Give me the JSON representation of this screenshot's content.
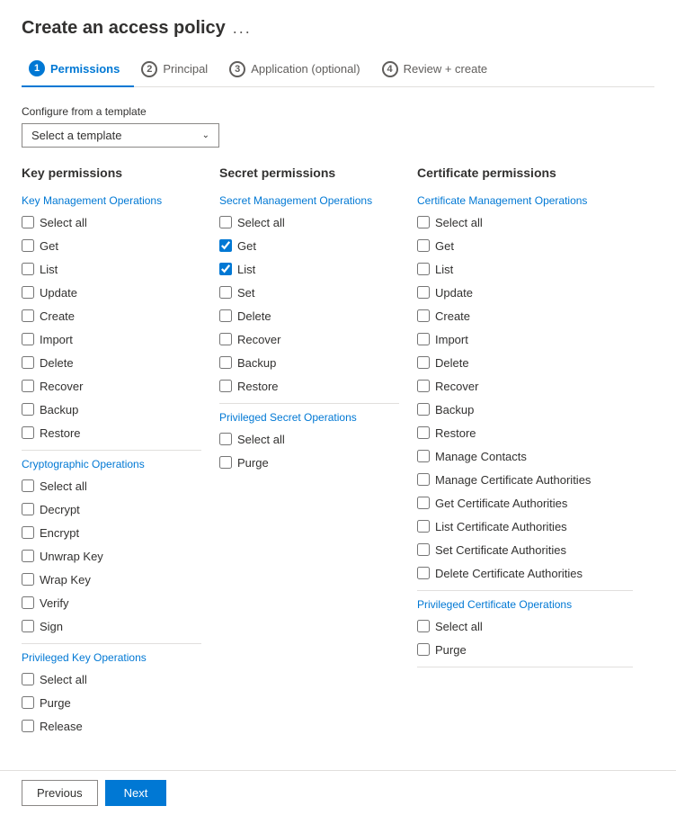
{
  "header": {
    "title": "Create an access policy",
    "dots": "..."
  },
  "steps": [
    {
      "id": 1,
      "label": "Permissions",
      "active": true
    },
    {
      "id": 2,
      "label": "Principal",
      "active": false
    },
    {
      "id": 3,
      "label": "Application (optional)",
      "active": false
    },
    {
      "id": 4,
      "label": "Review + create",
      "active": false
    }
  ],
  "template": {
    "label": "Configure from a template",
    "placeholder": "Select a template"
  },
  "key_permissions": {
    "title": "Key permissions",
    "sections": [
      {
        "label": "Key Management Operations",
        "items": [
          {
            "label": "Select all",
            "checked": false
          },
          {
            "label": "Get",
            "checked": false
          },
          {
            "label": "List",
            "checked": false
          },
          {
            "label": "Update",
            "checked": false
          },
          {
            "label": "Create",
            "checked": false
          },
          {
            "label": "Import",
            "checked": false
          },
          {
            "label": "Delete",
            "checked": false
          },
          {
            "label": "Recover",
            "checked": false
          },
          {
            "label": "Backup",
            "checked": false
          },
          {
            "label": "Restore",
            "checked": false
          }
        ]
      },
      {
        "label": "Cryptographic Operations",
        "items": [
          {
            "label": "Select all",
            "checked": false
          },
          {
            "label": "Decrypt",
            "checked": false
          },
          {
            "label": "Encrypt",
            "checked": false
          },
          {
            "label": "Unwrap Key",
            "checked": false
          },
          {
            "label": "Wrap Key",
            "checked": false
          },
          {
            "label": "Verify",
            "checked": false
          },
          {
            "label": "Sign",
            "checked": false
          }
        ]
      },
      {
        "label": "Privileged Key Operations",
        "items": [
          {
            "label": "Select all",
            "checked": false
          },
          {
            "label": "Purge",
            "checked": false
          },
          {
            "label": "Release",
            "checked": false
          }
        ]
      }
    ]
  },
  "secret_permissions": {
    "title": "Secret permissions",
    "sections": [
      {
        "label": "Secret Management Operations",
        "items": [
          {
            "label": "Select all",
            "checked": false
          },
          {
            "label": "Get",
            "checked": true
          },
          {
            "label": "List",
            "checked": true
          },
          {
            "label": "Set",
            "checked": false
          },
          {
            "label": "Delete",
            "checked": false
          },
          {
            "label": "Recover",
            "checked": false
          },
          {
            "label": "Backup",
            "checked": false
          },
          {
            "label": "Restore",
            "checked": false
          }
        ]
      },
      {
        "label": "Privileged Secret Operations",
        "items": [
          {
            "label": "Select all",
            "checked": false
          },
          {
            "label": "Purge",
            "checked": false
          }
        ]
      }
    ]
  },
  "certificate_permissions": {
    "title": "Certificate permissions",
    "sections": [
      {
        "label": "Certificate Management Operations",
        "items": [
          {
            "label": "Select all",
            "checked": false
          },
          {
            "label": "Get",
            "checked": false
          },
          {
            "label": "List",
            "checked": false
          },
          {
            "label": "Update",
            "checked": false
          },
          {
            "label": "Create",
            "checked": false
          },
          {
            "label": "Import",
            "checked": false
          },
          {
            "label": "Delete",
            "checked": false
          },
          {
            "label": "Recover",
            "checked": false
          },
          {
            "label": "Backup",
            "checked": false
          },
          {
            "label": "Restore",
            "checked": false
          },
          {
            "label": "Manage Contacts",
            "checked": false
          },
          {
            "label": "Manage Certificate Authorities",
            "checked": false
          },
          {
            "label": "Get Certificate Authorities",
            "checked": false
          },
          {
            "label": "List Certificate Authorities",
            "checked": false
          },
          {
            "label": "Set Certificate Authorities",
            "checked": false
          },
          {
            "label": "Delete Certificate Authorities",
            "checked": false
          }
        ]
      },
      {
        "label": "Privileged Certificate Operations",
        "items": [
          {
            "label": "Select all",
            "checked": false
          },
          {
            "label": "Purge",
            "checked": false
          }
        ]
      }
    ]
  },
  "footer": {
    "previous_label": "Previous",
    "next_label": "Next"
  }
}
